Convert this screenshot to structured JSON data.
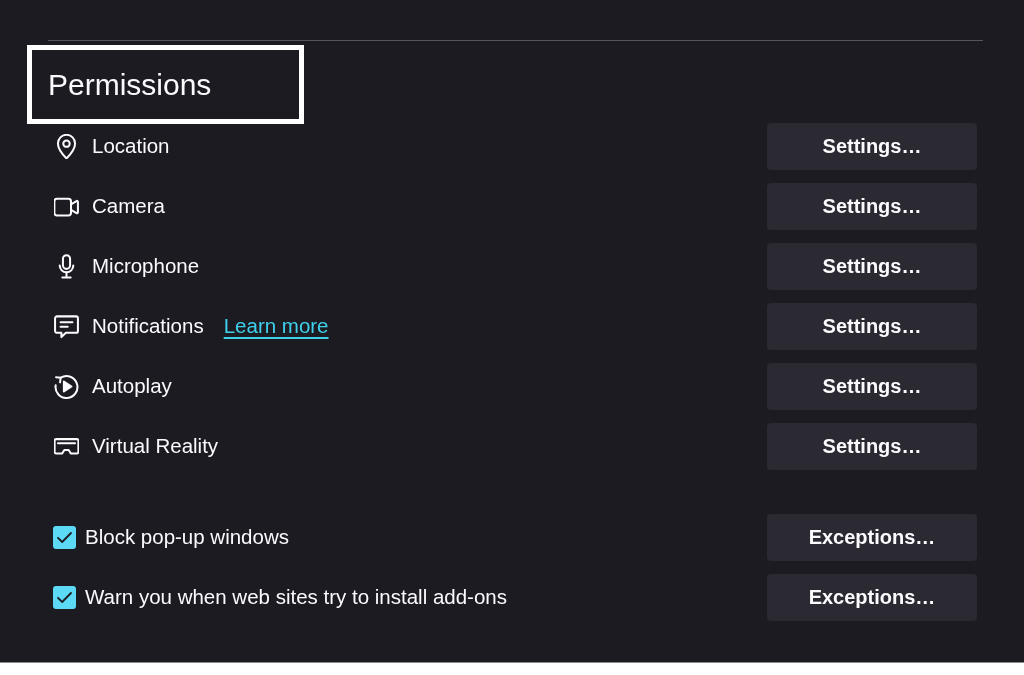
{
  "heading": {
    "text": "Permissions",
    "highlighted": true
  },
  "permissions": [
    {
      "label": "Location",
      "button": "Settings…"
    },
    {
      "label": "Camera",
      "button": "Settings…"
    },
    {
      "label": "Microphone",
      "button": "Settings…"
    },
    {
      "label": "Notifications",
      "link": "Learn more",
      "button": "Settings…"
    },
    {
      "label": "Autoplay",
      "button": "Settings…"
    },
    {
      "label": "Virtual Reality",
      "button": "Settings…"
    }
  ],
  "options": [
    {
      "label": "Block pop-up windows",
      "checked": true,
      "button": "Exceptions…"
    },
    {
      "label": "Warn you when web sites try to install add-ons",
      "checked": true,
      "button": "Exceptions…"
    }
  ]
}
